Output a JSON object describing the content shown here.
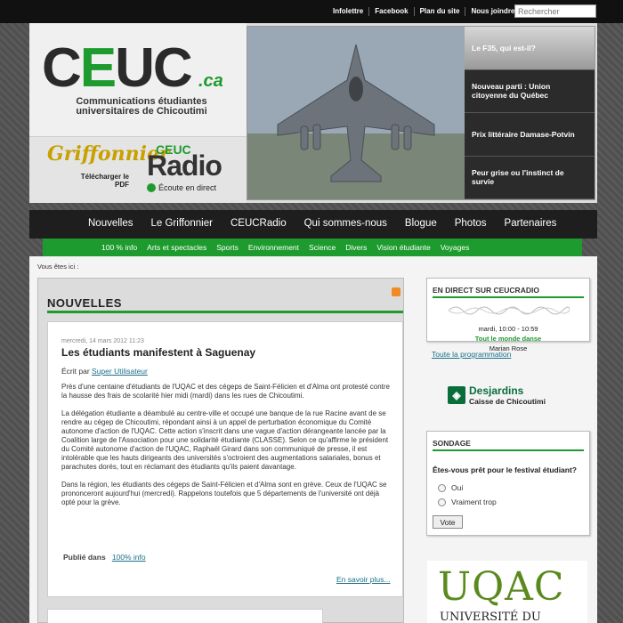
{
  "topbar": {
    "links": [
      "Infolettre",
      "Facebook",
      "Plan du site",
      "Nous joindre"
    ],
    "search_placeholder": "Rechercher"
  },
  "header": {
    "logo_text_pre": "C",
    "logo_text_e": "E",
    "logo_text_post": "UC",
    "logo_suffix": ".ca",
    "logo_subtitle": "Communications étudiantes universitaires de Chicoutimi",
    "griffonnier_title": "Griffonnier",
    "griffonnier_download": "Télécharger le PDF",
    "radio_brand": "CEUC",
    "radio_title": "Radio",
    "radio_listen": "Écoute en direct"
  },
  "feature": {
    "items": [
      "Le F35, qui est-il?",
      "Nouveau parti : Union citoyenne du Québec",
      "Prix littéraire Damase-Potvin",
      "Peur grise ou l'instinct de survie"
    ]
  },
  "mainnav": {
    "items": [
      "Nouvelles",
      "Le Griffonnier",
      "CEUCRadio",
      "Qui sommes-nous",
      "Blogue",
      "Photos",
      "Partenaires"
    ]
  },
  "subnav": {
    "items": [
      "100 % info",
      "Arts et spectacles",
      "Sports",
      "Environnement",
      "Science",
      "Divers",
      "Vision étudiante",
      "Voyages"
    ]
  },
  "breadcrumb": "Vous êtes ici :",
  "news": {
    "heading": "NOUVELLES",
    "article": {
      "date": "mercredi, 14 mars 2012 11:23",
      "title": "Les étudiants manifestent à Saguenay",
      "author_prefix": "Écrit par",
      "author": "Super Utilisateur",
      "paragraphs": [
        "Près d'une centaine d'étudiants de l'UQAC et des cégeps de Saint-Félicien et d'Alma ont protesté contre la hausse des frais de scolarité hier midi (mardi) dans les rues de Chicoutimi.",
        "La délégation étudiante a déambulé au centre-ville et occupé une banque de la rue Racine avant de se rendre au cégep de Chicoutimi, répondant ainsi à un appel de perturbation économique du Comité autonome d'action de l'UQAC. Cette action s'inscrit dans une vague d'action dérangeante lancée par la Coalition large de l'Association pour une solidarité étudiante (CLASSE). Selon ce qu'affirme le président du Comité autonome d'action de l'UQAC, Raphaël Girard dans son communiqué de presse, il est intolérable que les hauts dirigeants des universités s'octroient des augmentations salariales, bonus et parachutes dorés, tout en réclamant des étudiants qu'ils paient davantage.",
        "Dans la région, les étudiants des cégeps de Saint-Félicien et d'Alma sont en grève. Ceux de l'UQAC se prononceront aujourd'hui (mercredi). Rappelons toutefois que 5 départements de l'université ont déjà opté pour la grève."
      ],
      "published_label": "Publié dans",
      "category": "100% info",
      "more": "En savoir plus..."
    }
  },
  "radio_widget": {
    "title": "EN DIRECT SUR CEUCRADIO",
    "time": "mardi, 10:00 - 10:59",
    "show": "Tout le monde danse",
    "host": "Marian Rose",
    "program_link": "Toute la programmation"
  },
  "sponsor": {
    "name": "Desjardins",
    "sub": "Caisse de Chicoutimi"
  },
  "poll": {
    "title": "SONDAGE",
    "question": "Êtes-vous prêt pour le festival étudiant?",
    "options": [
      "Oui",
      "Vraiment trop"
    ],
    "vote": "Vote"
  },
  "uqac": {
    "logo": "UQAC",
    "sub": "UNIVERSITÉ DU QUÉBEC"
  },
  "colors": {
    "accent_green": "#1e9b2e",
    "nav_dark": "#1e1e1e",
    "link": "#1a6f8a"
  }
}
